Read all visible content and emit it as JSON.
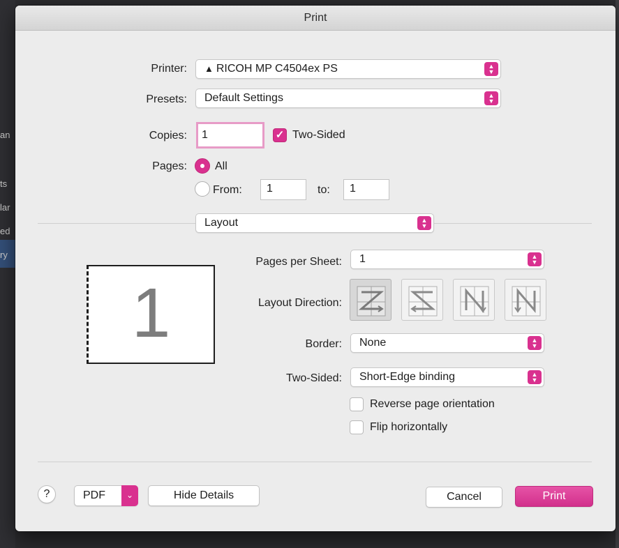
{
  "background": {
    "side_texts": [
      "an",
      "ts",
      "lar",
      "ed",
      "ry"
    ]
  },
  "dialog": {
    "title": "Print",
    "printer": {
      "label": "Printer:",
      "value": "RICOH MP C4504ex PS",
      "warning_glyph": "▲"
    },
    "presets": {
      "label": "Presets:",
      "value": "Default Settings"
    },
    "copies": {
      "label": "Copies:",
      "value": "1",
      "two_sided_label": "Two-Sided",
      "two_sided_checked": true
    },
    "pages": {
      "label": "Pages:",
      "all_label": "All",
      "from_label": "From:",
      "from_value": "1",
      "to_label": "to:",
      "to_value": "1"
    },
    "section_popup": "Layout",
    "preview_number": "1",
    "layout": {
      "pages_per_sheet_label": "Pages per Sheet:",
      "pages_per_sheet_value": "1",
      "layout_direction_label": "Layout Direction:",
      "border_label": "Border:",
      "border_value": "None",
      "two_sided_label": "Two-Sided:",
      "two_sided_value": "Short-Edge binding",
      "reverse_label": "Reverse page orientation",
      "flip_label": "Flip horizontally"
    },
    "footer": {
      "help": "?",
      "pdf": "PDF",
      "hide_details": "Hide Details",
      "cancel": "Cancel",
      "print": "Print"
    }
  },
  "colors": {
    "accent": "#d9318f",
    "dialog_bg": "#ececec"
  },
  "icons": {
    "up_down_arrows": "chevron-up-down-icon",
    "dropdown": "chevron-down-icon",
    "direction_icons": [
      "z-direction-icon",
      "reverse-z-direction-icon",
      "n-reversed-direction-icon",
      "n-direction-icon"
    ]
  }
}
